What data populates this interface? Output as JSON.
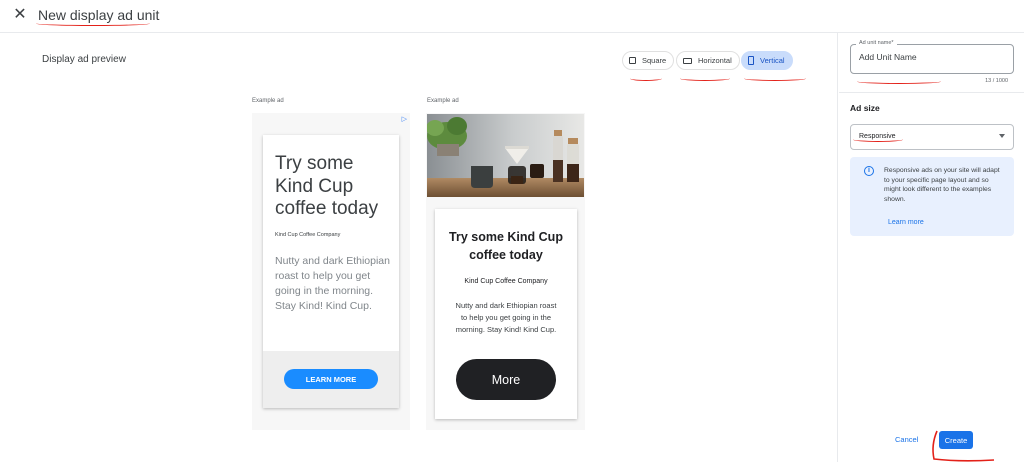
{
  "header": {
    "title": "New display ad unit",
    "close_icon": "close-icon"
  },
  "preview": {
    "label": "Display ad preview",
    "orientations": [
      {
        "label": "Square",
        "icon": "square-icon",
        "selected": false
      },
      {
        "label": "Horizontal",
        "icon": "horizontal-rect-icon",
        "selected": false
      },
      {
        "label": "Vertical",
        "icon": "vertical-rect-icon",
        "selected": true
      }
    ]
  },
  "ad1": {
    "label": "Example ad",
    "adchoices_icon": "adchoices-icon",
    "headline": "Try some Kind Cup coffee today",
    "company": "Kind Cup Coffee Company",
    "body": "Nutty and dark Ethiopian roast to help you get going in the morning. Stay Kind! Kind Cup.",
    "cta": "LEARN MORE"
  },
  "ad2": {
    "label": "Example ad",
    "image": "coffee-brewing-photo",
    "headline": "Try some Kind Cup coffee today",
    "company": "Kind Cup Coffee Company",
    "body": "Nutty and dark Ethiopian roast to help you get going in the morning. Stay Kind! Kind Cup.",
    "cta": "More"
  },
  "sidebar": {
    "name_label": "Ad unit name*",
    "name_value": "Add Unit Name",
    "char_count": "13 / 1000",
    "size_label": "Ad size",
    "size_value": "Responsive",
    "info_text": "Responsive ads on your site will adapt to your specific page layout and so might look different to the examples shown.",
    "learn_more": "Learn more",
    "cancel": "Cancel",
    "create": "Create"
  },
  "colors": {
    "primary": "#1a73e8",
    "selected_chip": "#c9dcfb",
    "annotation_red": "#e32119",
    "ad1_cta": "#1a8cff",
    "ad2_cta": "#202124"
  }
}
